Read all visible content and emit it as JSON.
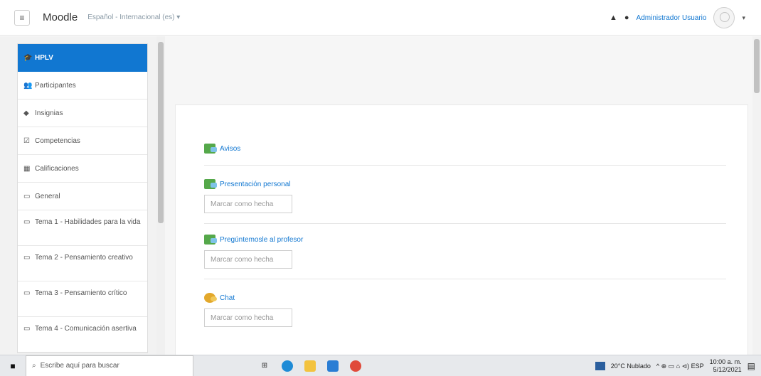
{
  "navbar": {
    "brand": "Moodle",
    "language": "Español - Internacional (es) ▾",
    "user_name": "Administrador Usuario",
    "icons": [
      "menu-icon",
      "bell-icon",
      "chat-icon",
      "caret-down-icon"
    ]
  },
  "drawer": {
    "items": [
      {
        "label": "HPLV",
        "icon": "graduation-cap-icon",
        "active": true
      },
      {
        "label": "Participantes",
        "icon": "users-icon"
      },
      {
        "label": "Insignias",
        "icon": "shield-icon"
      },
      {
        "label": "Competencias",
        "icon": "check-square-icon"
      },
      {
        "label": "Calificaciones",
        "icon": "table-icon"
      },
      {
        "label": "General",
        "icon": "folder-icon"
      },
      {
        "label": "Tema 1 - Habilidades para la vida",
        "icon": "folder-icon"
      },
      {
        "label": "Tema 2 - Pensamiento creativo",
        "icon": "folder-icon"
      },
      {
        "label": "Tema 3 - Pensamiento crítico",
        "icon": "folder-icon"
      },
      {
        "label": "Tema 4 - Comunicación asertiva",
        "icon": "folder-icon"
      }
    ]
  },
  "activities": [
    {
      "label": "Avisos",
      "icon": "forum-icon",
      "mark": ""
    },
    {
      "label": "Presentación personal",
      "icon": "forum-icon",
      "mark": "Marcar como hecha"
    },
    {
      "label": "Pregúntemosle al profesor",
      "icon": "forum-icon",
      "mark": "Marcar como hecha"
    },
    {
      "label": "Chat",
      "icon": "chat-bubble-icon",
      "mark": "Marcar como hecha"
    }
  ],
  "taskbar": {
    "search_placeholder": "Escribe aquí para buscar",
    "weather": "20°C Nublado",
    "tray_text": "^ ⊕ ▭ ⌂ ⊲) ESP",
    "time": "10:00 a. m.",
    "date": "5/12/2021"
  },
  "colors": {
    "accent": "#1177d1",
    "drawer_bg": "#f2f2f2",
    "forum_icon": "#55a84a",
    "chat_icon": "#e3a82b"
  }
}
